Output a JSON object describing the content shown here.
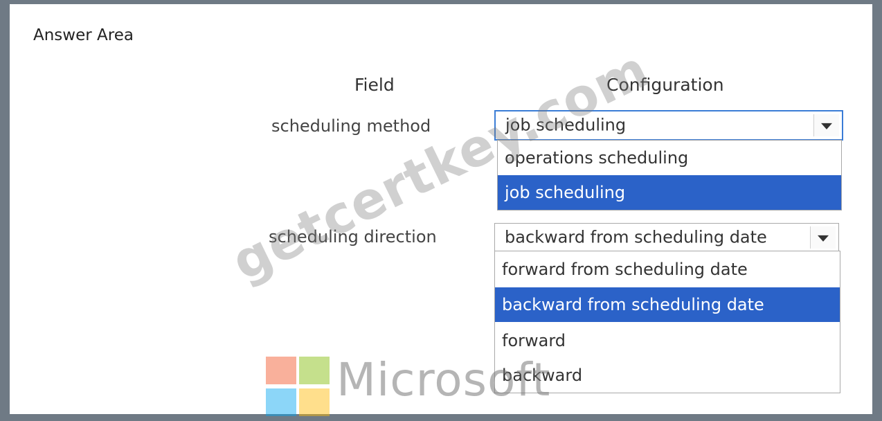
{
  "answer_area": {
    "title": "Answer Area"
  },
  "headers": {
    "field": "Field",
    "configuration": "Configuration"
  },
  "rows": [
    {
      "label": "scheduling method",
      "selected_value": "job scheduling",
      "options": [
        "operations scheduling",
        "job scheduling"
      ],
      "highlighted": "job scheduling"
    },
    {
      "label": "scheduling direction",
      "selected_value": "backward from scheduling date",
      "options": [
        "forward from scheduling date",
        "backward from scheduling date",
        "forward",
        "backward"
      ],
      "highlighted": "backward from scheduling date"
    }
  ],
  "watermark": {
    "text": "getcertkey.com"
  },
  "logo": {
    "text": "Microsoft",
    "colors": [
      "#f25022",
      "#7fba00",
      "#00a4ef",
      "#ffb900"
    ]
  },
  "colors": {
    "highlight": "#2b62c8",
    "frame": "#6f7a85",
    "focus_border": "#3a7cd6"
  }
}
